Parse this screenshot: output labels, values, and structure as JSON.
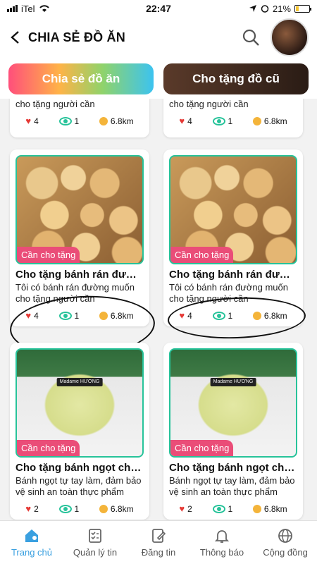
{
  "status": {
    "carrier": "iTel",
    "time": "22:47",
    "battery": "21%",
    "battery_level": 0.21
  },
  "header": {
    "title": "CHIA SẺ ĐỒ ĂN"
  },
  "tabs": [
    {
      "label": "Chia sẻ đồ ăn"
    },
    {
      "label": "Cho tặng đồ cũ"
    }
  ],
  "top_cards": [
    {
      "desc": "cho tặng người cần",
      "likes": "4",
      "views": "1",
      "distance": "6.8km"
    },
    {
      "desc": "cho tặng người cần",
      "likes": "4",
      "views": "1",
      "distance": "6.8km"
    }
  ],
  "cards": [
    {
      "badge": "Cần cho tặng",
      "title": "Cho tặng bánh rán đường",
      "desc": "Tôi có bánh rán đường muốn cho tặng người cần",
      "likes": "4",
      "views": "1",
      "distance": "6.8km"
    },
    {
      "badge": "Cần cho tặng",
      "title": "Cho tặng bánh rán đường",
      "desc": "Tôi có bánh rán đường muốn cho tặng người cần",
      "likes": "4",
      "views": "1",
      "distance": "6.8km"
    },
    {
      "badge": "Cần cho tặng",
      "title": "Cho tặng bánh ngọt cho tr...",
      "desc": "Bánh ngọt tự tay làm, đảm bảo vệ sinh an toàn thực phẩm",
      "likes": "2",
      "views": "1",
      "distance": "6.8km",
      "cake_label": "Madame HƯƠNG"
    },
    {
      "badge": "Cần cho tặng",
      "title": "Cho tặng bánh ngọt cho tr...",
      "desc": "Bánh ngọt tự tay làm, đảm bảo vệ sinh an toàn thực phẩm",
      "likes": "2",
      "views": "1",
      "distance": "6.8km",
      "cake_label": "Madame HƯƠNG"
    }
  ],
  "nav": [
    {
      "label": "Trang chủ",
      "icon": "home-location-icon"
    },
    {
      "label": "Quản lý tin",
      "icon": "checklist-icon"
    },
    {
      "label": "Đăng tin",
      "icon": "edit-document-icon"
    },
    {
      "label": "Thông báo",
      "icon": "bell-icon"
    },
    {
      "label": "Cộng đồng",
      "icon": "globe-icon"
    }
  ],
  "colors": {
    "accent": "#3aa0e0",
    "badge": "#ea4d78",
    "card_border": "#27c39a",
    "heart": "#e53935"
  }
}
